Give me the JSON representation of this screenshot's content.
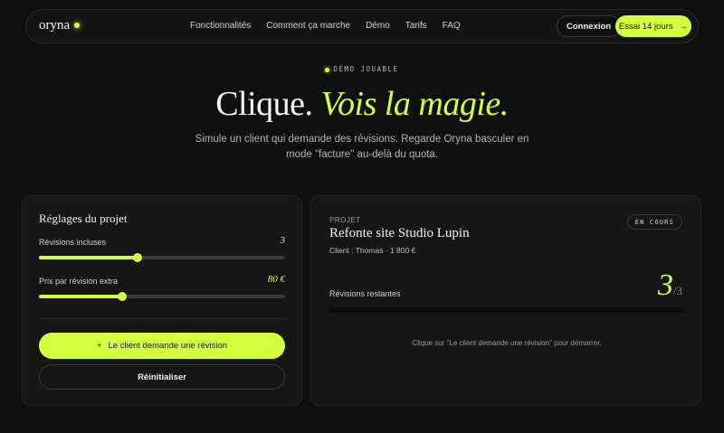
{
  "nav": {
    "logo": "oryna",
    "links": [
      "Fonctionnalités",
      "Comment ça marche",
      "Démo",
      "Tarifs",
      "FAQ"
    ],
    "login_label": "Connexion",
    "trial_label": "Essai 14 jours",
    "trial_icon": "arrow-right-icon"
  },
  "hero": {
    "badge": "DÉMO JOUABLE",
    "title_part1": "Clique.",
    "title_part2": "Vois la magie.",
    "subtitle": "Simule un client qui demande des révisions. Regarde Oryna basculer en mode \"facture\" au-delà du quota."
  },
  "settings": {
    "title": "Réglages du projet",
    "revisions_label": "Révisions incluses",
    "revisions_value": "3",
    "revisions_level": 0.4,
    "price_label": "Prix par révision extra",
    "price_value": "80 €",
    "price_level": 0.34,
    "demand_label": "Le client demande une révision",
    "demand_icon": "plus-icon",
    "reset_label": "Réinitialiser"
  },
  "project": {
    "kicker": "PROJET",
    "title": "Refonte site Studio Lupin",
    "client": "Client : Thomas · 1 800 €",
    "status": "EN COURS",
    "remaining_label": "Révisions restantes",
    "remaining_count": "3",
    "remaining_total": "/3",
    "progress": 0,
    "hint": "Clique sur \"Le client demande une révision\" pour démarrer."
  },
  "colors": {
    "accent": "#d4ff3f",
    "background": "#0f0f10",
    "panel": "#161617"
  }
}
